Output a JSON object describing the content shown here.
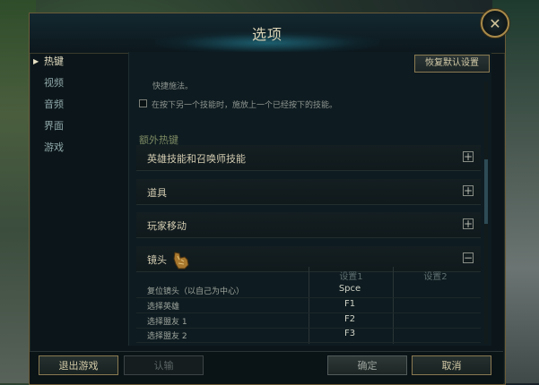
{
  "dialog": {
    "title": "选项",
    "close_label": "✕"
  },
  "sidebar": {
    "items": [
      {
        "label": "热键",
        "active": true
      },
      {
        "label": "视频",
        "active": false
      },
      {
        "label": "音频",
        "active": false
      },
      {
        "label": "界面",
        "active": false
      },
      {
        "label": "游戏",
        "active": false
      }
    ]
  },
  "content": {
    "restore_label": "恢复默认设置",
    "partial_line": "快捷施法。",
    "checkbox_text": "在按下另一个技能时，施放上一个已经按下的技能。",
    "section_extra": "额外热键",
    "groups": [
      {
        "label": "英雄技能和召唤师技能",
        "toggle": "+"
      },
      {
        "label": "道具",
        "toggle": "+"
      },
      {
        "label": "玩家移动",
        "toggle": "+"
      },
      {
        "label": "镜头",
        "toggle": "−"
      }
    ],
    "table": {
      "col1": "设置1",
      "col2": "设置2",
      "rows": [
        {
          "name": "复位镜头（以自己为中心）",
          "key1": "Spce",
          "key2": ""
        },
        {
          "name": "选择英雄",
          "key1": "F1",
          "key2": ""
        },
        {
          "name": "选择盟友 1",
          "key1": "F2",
          "key2": ""
        },
        {
          "name": "选择盟友 2",
          "key1": "F3",
          "key2": ""
        }
      ]
    }
  },
  "footer": {
    "quit_label": "退出游戏",
    "surrender_label": "认输",
    "ok_label": "确定",
    "cancel_label": "取消"
  },
  "colors": {
    "accent_gold": "#8a7a52",
    "title_glow": "#2896af",
    "panel_bg": "#0e1b20"
  }
}
